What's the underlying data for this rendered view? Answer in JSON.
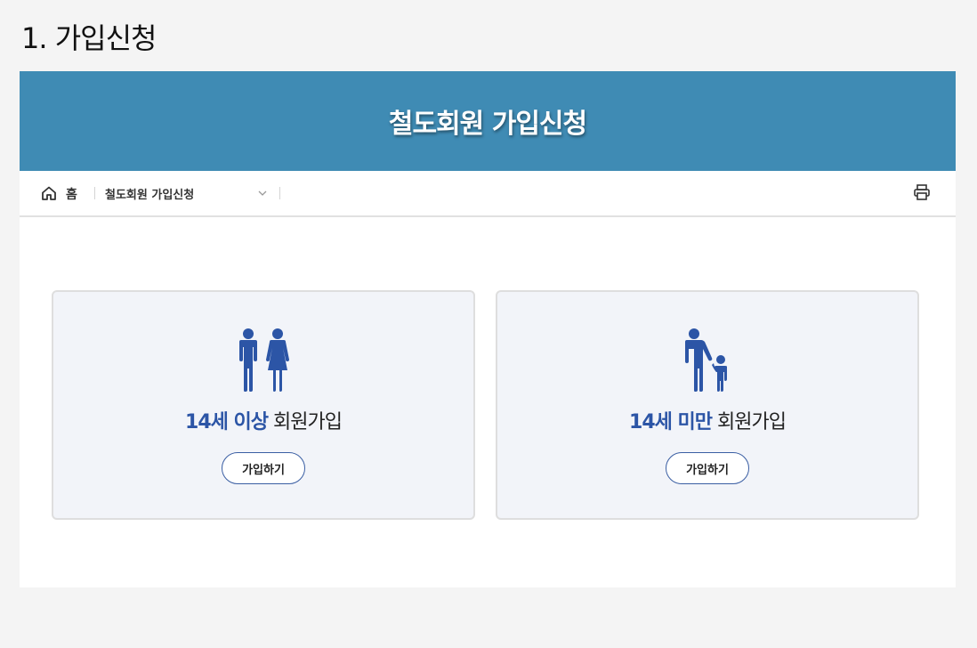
{
  "section": {
    "title": "1. 가입신청"
  },
  "banner": {
    "title": "철도회원 가입신청"
  },
  "breadcrumb": {
    "home_label": "홈",
    "current_label": "철도회원 가입신청"
  },
  "cards": [
    {
      "accent_text": "14세 이상",
      "title_text": " 회원가입",
      "button_label": "가입하기",
      "icon": "adult-couple-icon"
    },
    {
      "accent_text": "14세 미만",
      "title_text": " 회원가입",
      "button_label": "가입하기",
      "icon": "parent-child-icon"
    }
  ],
  "colors": {
    "banner": "#3f8bb4",
    "accent": "#2c55a6",
    "card_bg": "#f2f4f9",
    "icon": "#2c55a6"
  }
}
